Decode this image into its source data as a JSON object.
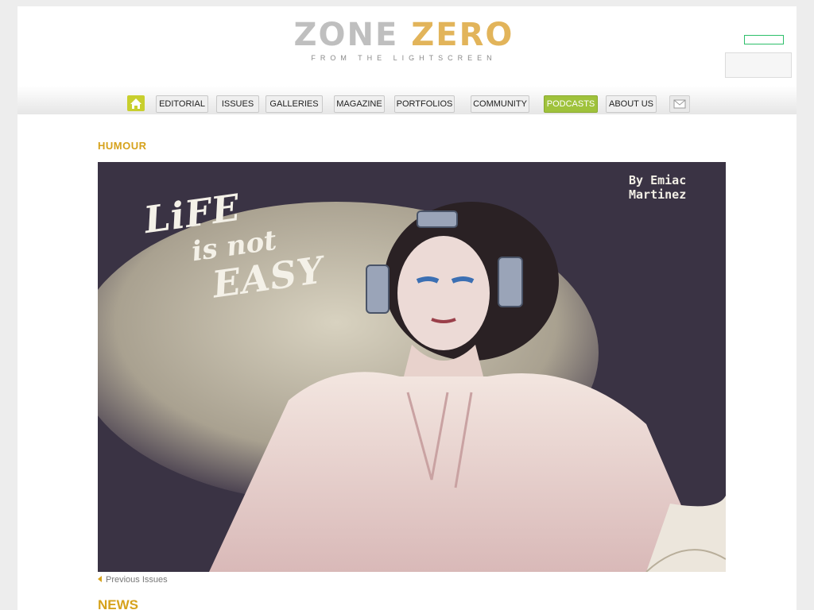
{
  "site": {
    "logo_zone": "ZONE",
    "logo_zero": "ZERO",
    "logo_tagline": "FROM THE LIGHTSCREEN"
  },
  "nav": {
    "items": [
      {
        "label": "EDITORIAL"
      },
      {
        "label": "ISSUES"
      },
      {
        "label": "GALLERIES"
      },
      {
        "label": "MAGAZINE"
      },
      {
        "label": "PORTFOLIOS"
      },
      {
        "label": "COMMUNITY"
      },
      {
        "label": "PODCASTS"
      },
      {
        "label": "ABOUT US"
      }
    ],
    "home_icon": "home-icon",
    "mail_icon": "mail-icon"
  },
  "feature": {
    "section": "HUMOUR",
    "title_line1": "LiFE",
    "title_line2": "is not",
    "title_line3": "EASY",
    "byline": "By Emiac Martinez"
  },
  "links": {
    "previous_issues": "Previous Issues"
  },
  "sections": {
    "news": "NEWS"
  },
  "colors": {
    "accent": "#d6a21c",
    "podcasts_bg": "#9fc23b",
    "home_bg": "#c8cf2e"
  }
}
